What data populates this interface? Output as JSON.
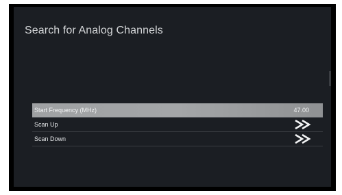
{
  "page": {
    "title": "Search for Analog Channels"
  },
  "menu": {
    "items": [
      {
        "label": "Start Frequency (MHz)",
        "value": "47.00",
        "selected": true
      },
      {
        "label": "Scan Up",
        "icon": "double-chevron-right-icon"
      },
      {
        "label": "Scan Down",
        "icon": "double-chevron-right-icon"
      }
    ]
  },
  "colors": {
    "screen_background": "#1b1e23",
    "selected_row": "#a4a6a8",
    "text": "#e4e6e8"
  }
}
